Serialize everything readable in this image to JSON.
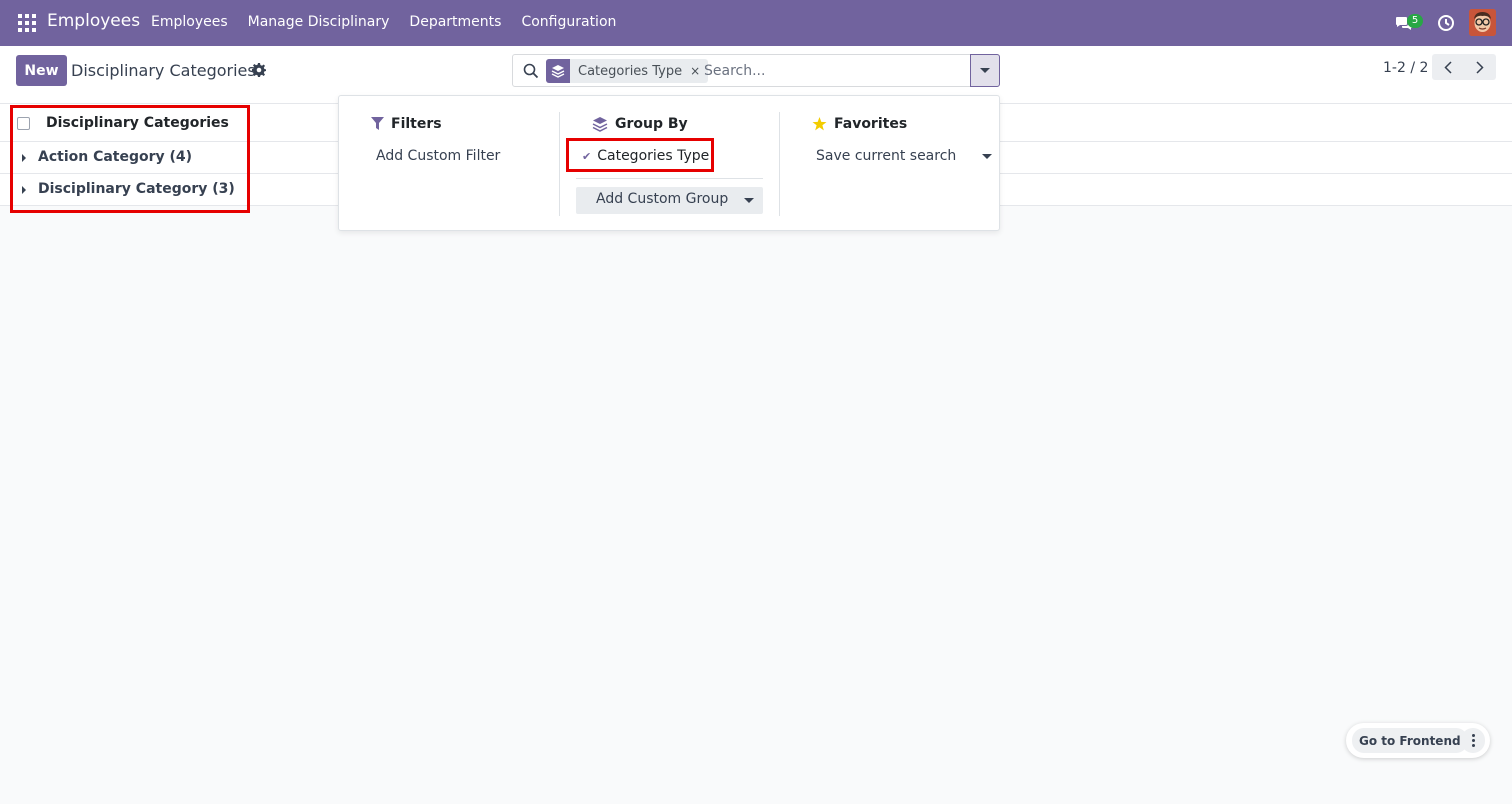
{
  "navbar": {
    "app_title": "Employees",
    "menu": [
      "Employees",
      "Manage Disciplinary",
      "Departments",
      "Configuration"
    ],
    "chat_badge": "5"
  },
  "control_panel": {
    "new_label": "New",
    "title": "Disciplinary Categories",
    "pager": "1-2 / 2"
  },
  "search": {
    "facet_label": "Categories Type",
    "facet_remove": "×",
    "placeholder": "Search..."
  },
  "list": {
    "header": "Disciplinary Categories",
    "groups": [
      {
        "label": "Action Category (4)"
      },
      {
        "label": "Disciplinary Category (3)"
      }
    ]
  },
  "dropdown": {
    "filters": {
      "title": "Filters",
      "add_custom_filter": "Add Custom Filter"
    },
    "group_by": {
      "title": "Group By",
      "active_item": "Categories Type",
      "add_custom_group": "Add Custom Group"
    },
    "favorites": {
      "title": "Favorites",
      "save_current_search": "Save current search"
    }
  },
  "floating": {
    "go_to_frontend": "Go to Frontend"
  },
  "colors": {
    "brand": "#71639e",
    "highlight": "#e60000",
    "badge": "#28a745",
    "favorites_star": "#f3cc00"
  }
}
